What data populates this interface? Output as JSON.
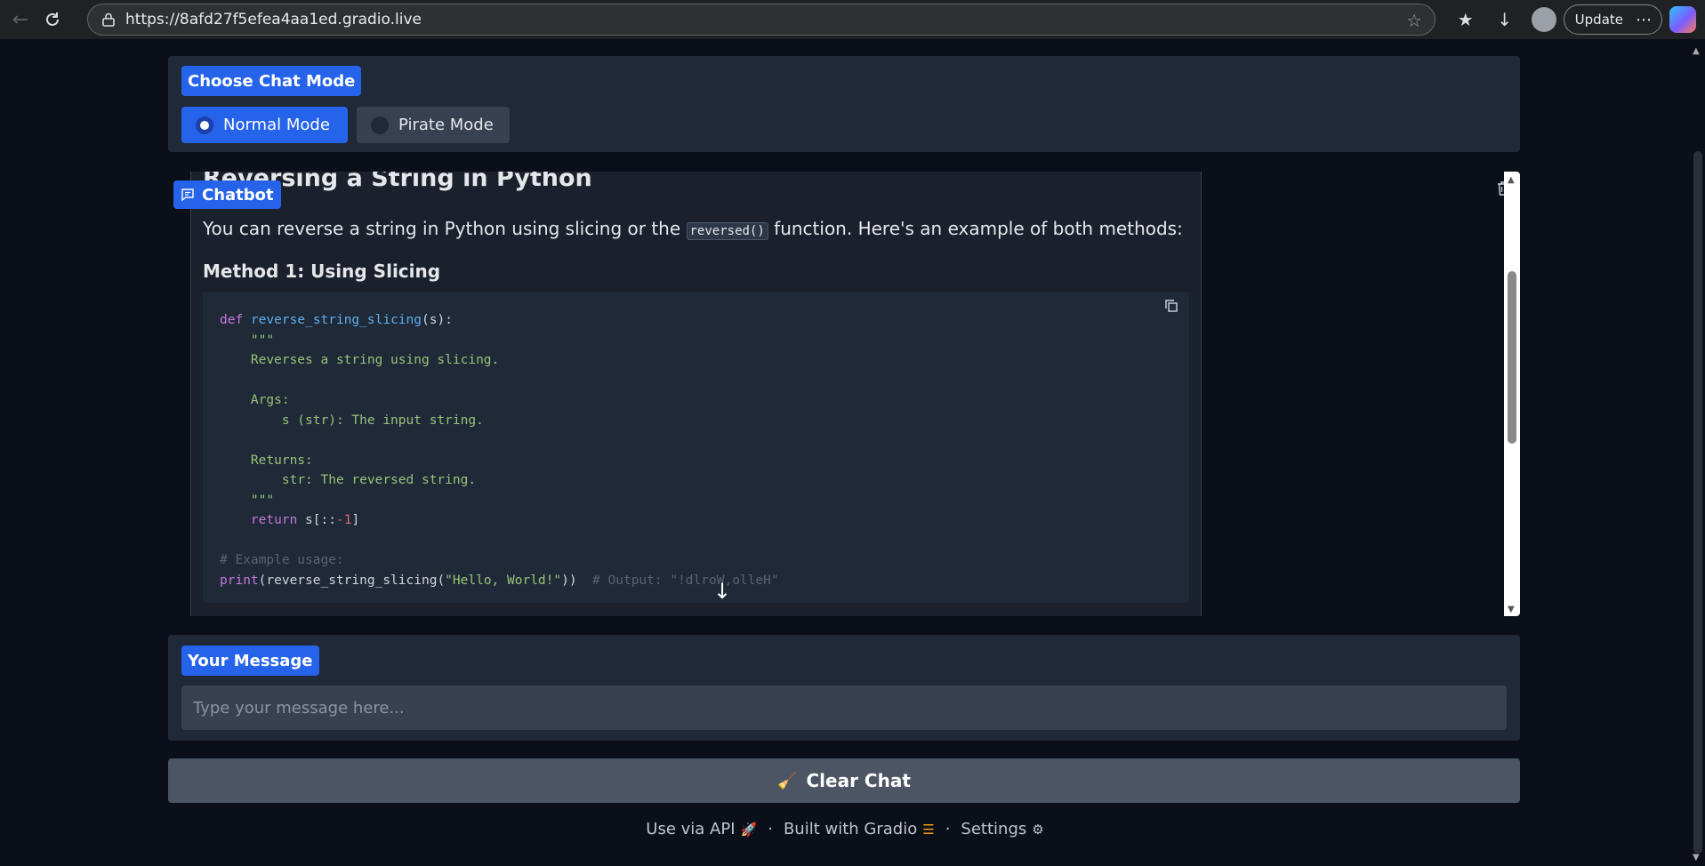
{
  "browser": {
    "url": "https://8afd27f5efea4aa1ed.gradio.live",
    "update_label": "Update"
  },
  "mode": {
    "label": "Choose Chat Mode",
    "options": [
      "Normal Mode",
      "Pirate Mode"
    ],
    "selected": "Normal Mode"
  },
  "chatbot": {
    "label": "Chatbot",
    "message": {
      "heading": "Reversing a String in Python",
      "intro_before": "You can reverse a string in Python using slicing or the ",
      "intro_code": "reversed()",
      "intro_after": " function. Here's an example of both methods:",
      "method_heading": "Method 1: Using Slicing",
      "code_lines": [
        "def reverse_string_slicing(s):",
        "    \"\"\"",
        "    Reverses a string using slicing.",
        "",
        "    Args:",
        "        s (str): The input string.",
        "",
        "    Returns:",
        "        str: The reversed string.",
        "    \"\"\"",
        "    return s[::-1]",
        "",
        "# Example usage:",
        "print(reverse_string_slicing(\"Hello, World!\"))  # Output: \"!dlroW,olleH\""
      ]
    }
  },
  "input": {
    "label": "Your Message",
    "placeholder": "Type your message here..."
  },
  "clear_button": "Clear Chat",
  "footer": {
    "api": "Use via API",
    "built": "Built with Gradio",
    "settings": "Settings",
    "separator": "·"
  },
  "colors": {
    "accent": "#2563eb",
    "panel": "#1f2937",
    "background": "#0b0f19"
  },
  "icons": [
    "back-icon",
    "reload-icon",
    "lock-icon",
    "star-icon",
    "favorites-icon",
    "download-icon",
    "avatar",
    "more-icon",
    "copilot-icon",
    "chat-icon",
    "trash-icon",
    "copy-icon",
    "scroll-down-icon",
    "broom-icon",
    "rocket-icon",
    "gradio-logo-icon",
    "gear-icon"
  ]
}
